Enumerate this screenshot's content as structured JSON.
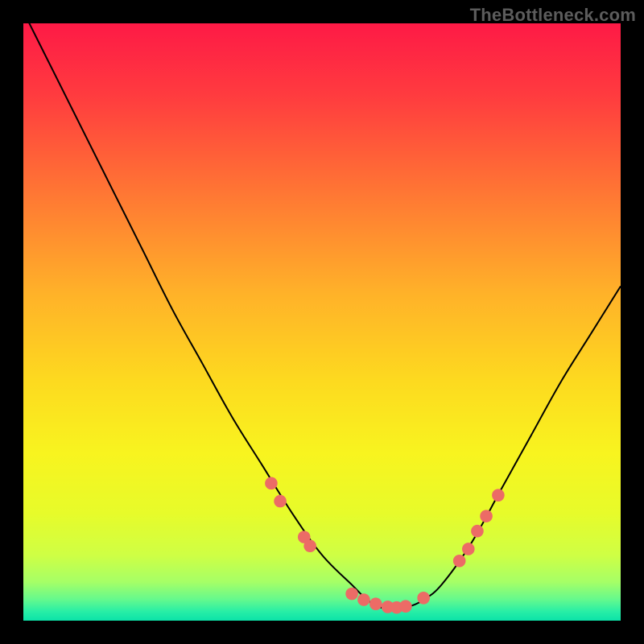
{
  "watermark": "TheBottleneck.com",
  "chart_data": {
    "type": "line",
    "title": "",
    "xlabel": "",
    "ylabel": "",
    "xlim": [
      0,
      100
    ],
    "ylim": [
      0,
      100
    ],
    "series": [
      {
        "name": "bottleneck-curve",
        "x": [
          0,
          5,
          10,
          15,
          20,
          25,
          30,
          35,
          40,
          45,
          50,
          55,
          57,
          59,
          61,
          63,
          65,
          67,
          70,
          75,
          80,
          85,
          90,
          95,
          100
        ],
        "y": [
          102,
          92,
          82,
          72,
          62,
          52,
          43,
          34,
          26,
          18,
          11,
          6,
          4,
          2.5,
          2,
          2,
          2.5,
          3.5,
          6,
          13,
          22,
          31,
          40,
          48,
          56
        ]
      }
    ],
    "markers": {
      "name": "highlighted-points",
      "color": "#ec6b66",
      "points": [
        {
          "x": 41.5,
          "y": 23
        },
        {
          "x": 43,
          "y": 20
        },
        {
          "x": 47,
          "y": 14
        },
        {
          "x": 48,
          "y": 12.5
        },
        {
          "x": 55,
          "y": 4.5
        },
        {
          "x": 57,
          "y": 3.5
        },
        {
          "x": 59,
          "y": 2.8
        },
        {
          "x": 61,
          "y": 2.3
        },
        {
          "x": 62.5,
          "y": 2.2
        },
        {
          "x": 64,
          "y": 2.4
        },
        {
          "x": 67,
          "y": 3.8
        },
        {
          "x": 73,
          "y": 10
        },
        {
          "x": 74.5,
          "y": 12
        },
        {
          "x": 76,
          "y": 15
        },
        {
          "x": 77.5,
          "y": 17.5
        },
        {
          "x": 79.5,
          "y": 21
        }
      ]
    },
    "background": {
      "type": "vertical-gradient",
      "stops": [
        {
          "offset": 0.0,
          "color": "#fe1a46"
        },
        {
          "offset": 0.12,
          "color": "#ff3b3f"
        },
        {
          "offset": 0.28,
          "color": "#ff7534"
        },
        {
          "offset": 0.45,
          "color": "#ffb129"
        },
        {
          "offset": 0.6,
          "color": "#fdda1f"
        },
        {
          "offset": 0.72,
          "color": "#f8f41f"
        },
        {
          "offset": 0.82,
          "color": "#e7fb2a"
        },
        {
          "offset": 0.89,
          "color": "#cfff44"
        },
        {
          "offset": 0.935,
          "color": "#a6ff66"
        },
        {
          "offset": 0.965,
          "color": "#63f98e"
        },
        {
          "offset": 0.985,
          "color": "#27eea6"
        },
        {
          "offset": 1.0,
          "color": "#0be3a8"
        }
      ]
    }
  }
}
